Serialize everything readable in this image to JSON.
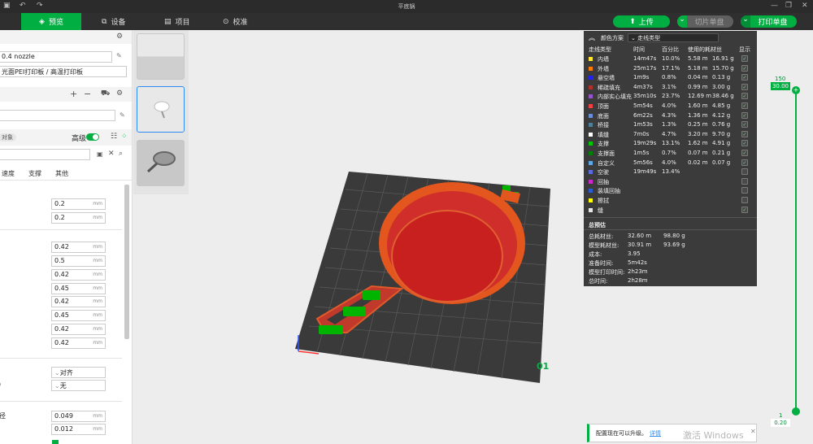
{
  "titlebar": {
    "title": "平底锅"
  },
  "tabs": [
    {
      "label": "首页"
    },
    {
      "label": "预览"
    },
    {
      "label": "设备"
    },
    {
      "label": "项目"
    },
    {
      "label": "校准"
    }
  ],
  "toolbar": {
    "upload": "上传",
    "slice": "切片单盘",
    "print": "打印单盘"
  },
  "left": {
    "printer": "0.4 nozzle",
    "plate": "光面PEI打印板 / 高温打印板",
    "object_tag": "对象",
    "advanced": "高级",
    "tabs": [
      "速度",
      "支撑",
      "其他"
    ],
    "group1": [
      {
        "v": "0.2",
        "u": "mm"
      },
      {
        "v": "0.2",
        "u": "mm"
      }
    ],
    "group2": [
      {
        "v": "0.42",
        "u": "mm"
      },
      {
        "v": "0.5",
        "u": "mm"
      },
      {
        "v": "0.42",
        "u": "mm"
      },
      {
        "v": "0.45",
        "u": "mm"
      },
      {
        "v": "0.42",
        "u": "mm"
      },
      {
        "v": "0.45",
        "u": "mm"
      },
      {
        "v": "0.42",
        "u": "mm"
      },
      {
        "v": "0.42",
        "u": "mm"
      }
    ],
    "sel1": "对齐",
    "sel2_label": ")",
    "sel2": "无",
    "group3_label": "径",
    "group3": [
      {
        "v": "0.049",
        "u": "mm"
      },
      {
        "v": "0.012",
        "u": "mm"
      }
    ]
  },
  "legend": {
    "scheme_label": "颜色方案",
    "scheme_value": "走线类型",
    "headers": [
      "走线类型",
      "时间",
      "百分比",
      "使用的耗材丝",
      "显示"
    ],
    "rows": [
      {
        "name": "内墙",
        "time": "14m47s",
        "pct": "10.0%",
        "len": "5.58 m",
        "wt": "16.91 g",
        "color": "#ffe632",
        "show": true
      },
      {
        "name": "外墙",
        "time": "25m17s",
        "pct": "17.1%",
        "len": "5.18 m",
        "wt": "15.70 g",
        "color": "#ff7b00",
        "show": true
      },
      {
        "name": "悬空墙",
        "time": "1m9s",
        "pct": "0.8%",
        "len": "0.04 m",
        "wt": "0.13 g",
        "color": "#2020ff",
        "show": true
      },
      {
        "name": "稀疏填充",
        "time": "4m37s",
        "pct": "3.1%",
        "len": "0.99 m",
        "wt": "3.00 g",
        "color": "#b03029",
        "show": true
      },
      {
        "name": "内部实心填充",
        "time": "35m10s",
        "pct": "23.7%",
        "len": "12.69 m",
        "wt": "38.46 g",
        "color": "#9654cc",
        "show": true
      },
      {
        "name": "顶面",
        "time": "5m54s",
        "pct": "4.0%",
        "len": "1.60 m",
        "wt": "4.85 g",
        "color": "#f04040",
        "show": true
      },
      {
        "name": "底面",
        "time": "6m22s",
        "pct": "4.3%",
        "len": "1.36 m",
        "wt": "4.12 g",
        "color": "#6a8fd8",
        "show": true
      },
      {
        "name": "桥接",
        "time": "1m53s",
        "pct": "1.3%",
        "len": "0.25 m",
        "wt": "0.76 g",
        "color": "#4d8099",
        "show": true
      },
      {
        "name": "填缝",
        "time": "7m0s",
        "pct": "4.7%",
        "len": "3.20 m",
        "wt": "9.70 g",
        "color": "#ffffff",
        "show": true
      },
      {
        "name": "支撑",
        "time": "19m29s",
        "pct": "13.1%",
        "len": "1.62 m",
        "wt": "4.91 g",
        "color": "#00c800",
        "show": true
      },
      {
        "name": "支撑面",
        "time": "1m5s",
        "pct": "0.7%",
        "len": "0.07 m",
        "wt": "0.21 g",
        "color": "#008000",
        "show": true
      },
      {
        "name": "自定义",
        "time": "5m56s",
        "pct": "4.0%",
        "len": "0.02 m",
        "wt": "0.07 g",
        "color": "#5ea8e8",
        "show": true
      },
      {
        "name": "空驶",
        "time": "19m49s",
        "pct": "13.4%",
        "len": "",
        "wt": "",
        "color": "#5a6be0",
        "show": false
      },
      {
        "name": "回抽",
        "time": "",
        "pct": "",
        "len": "",
        "wt": "",
        "color": "#cc29cc",
        "show": false
      },
      {
        "name": "装填回抽",
        "time": "",
        "pct": "",
        "len": "",
        "wt": "",
        "color": "#2a5cd6",
        "show": false
      },
      {
        "name": "擦拭",
        "time": "",
        "pct": "",
        "len": "",
        "wt": "",
        "color": "#ffff00",
        "show": false
      },
      {
        "name": "缝",
        "time": "",
        "pct": "",
        "len": "",
        "wt": "",
        "color": "#e6e6e6",
        "show": true
      }
    ],
    "summary_title": "总预估",
    "summary": [
      {
        "k": "总耗材丝:",
        "a": "32.60 m",
        "b": "98.80 g"
      },
      {
        "k": "模型耗材丝:",
        "a": "30.91 m",
        "b": "93.69 g"
      },
      {
        "k": "成本:",
        "a": "3.95",
        "b": ""
      },
      {
        "k": "准备时间:",
        "a": "5m42s",
        "b": ""
      },
      {
        "k": "模型打印时间:",
        "a": "2h23m",
        "b": ""
      },
      {
        "k": "总时间:",
        "a": "2h28m",
        "b": ""
      }
    ]
  },
  "slider": {
    "top_layer": "150",
    "top_height": "30.00",
    "bottom_layer": "1",
    "bottom_height": "0.20"
  },
  "plate": {
    "number": "01"
  },
  "notification": {
    "text": "配置现在可以升级。",
    "link": "详情"
  },
  "watermark": "激活 Windows",
  "colors": {
    "accent": "#00ae42",
    "legend_bg": "#3b3b3b"
  }
}
